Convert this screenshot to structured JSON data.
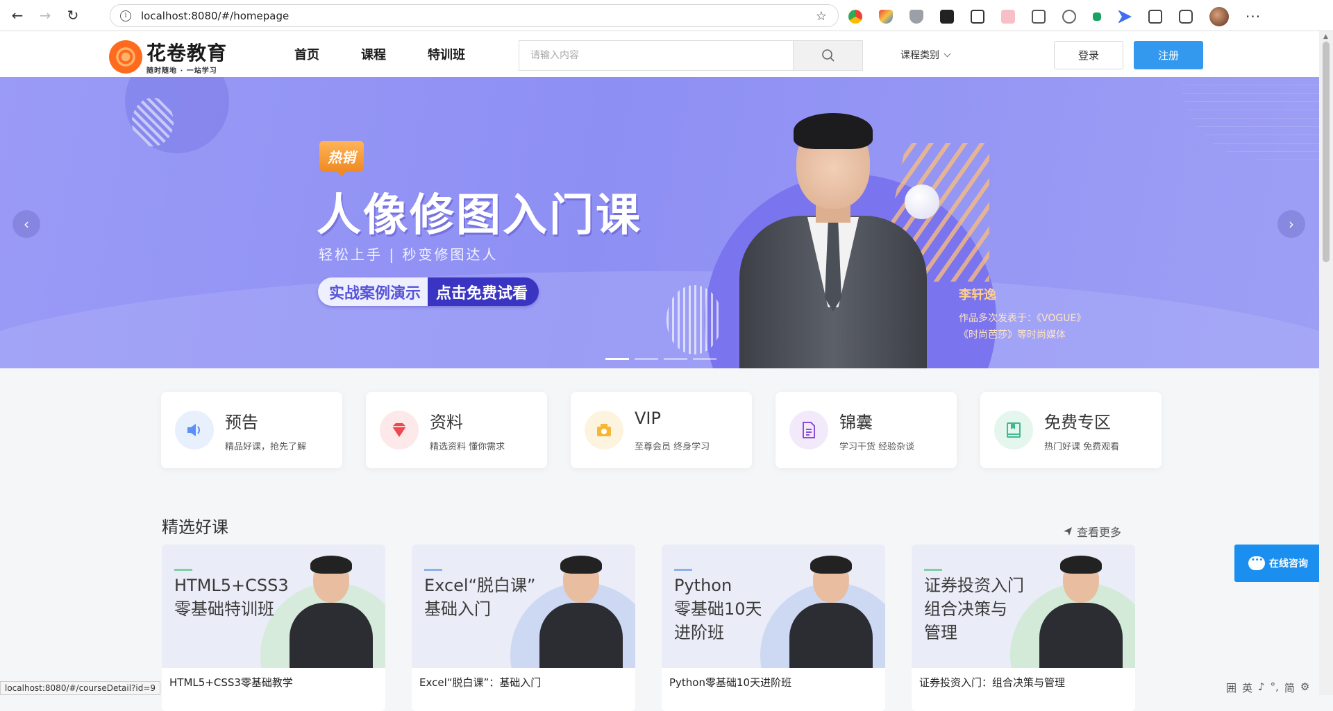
{
  "browser": {
    "url": "localhost:8080/#/homepage",
    "status_url": "localhost:8080/#/courseDetail?id=9"
  },
  "header": {
    "logo_title": "花卷教育",
    "logo_slogan": "随时随地 · 一站学习",
    "nav": [
      "首页",
      "课程",
      "特训班"
    ],
    "search_placeholder": "请输入内容",
    "category_label": "课程类别",
    "login_label": "登录",
    "register_label": "注册"
  },
  "banner": {
    "badge": "热销",
    "title": "人像修图入门课",
    "subtitle": "轻松上手 | 秒变修图达人",
    "cta_left": "实战案例演示",
    "cta_right": "点击免费试看",
    "lecturer_name": "李轩逸",
    "lecturer_desc_1": "作品多次发表于：《VOGUE》",
    "lecturer_desc_2": "《时尚芭莎》等时尚媒体",
    "prev": "‹",
    "next": "›",
    "slides": 4,
    "active_slide": 0
  },
  "categories": [
    {
      "title": "预告",
      "desc": "精品好课，抢先了解",
      "icon": "speaker-icon",
      "color": "#5b8ff9",
      "bg": "#e8effd"
    },
    {
      "title": "资料",
      "desc": "精选资料 懂你需求",
      "icon": "diamond-icon",
      "color": "#f0484f",
      "bg": "#fde9ea"
    },
    {
      "title": "VIP",
      "desc": "至尊会员 终身学习",
      "icon": "crown-icon",
      "color": "#f7b732",
      "bg": "#fdf4df"
    },
    {
      "title": "锦囊",
      "desc": "学习干货 经验杂谈",
      "icon": "document-icon",
      "color": "#8a4fd6",
      "bg": "#f2eafb"
    },
    {
      "title": "免费专区",
      "desc": "热门好课 免费观看",
      "icon": "book-icon",
      "color": "#3dbb8b",
      "bg": "#e4f6ee"
    }
  ],
  "section": {
    "title": "精选好课",
    "see_more": "查看更多"
  },
  "courses": [
    {
      "cover_text": "HTML5+CSS3\n零基础特训班",
      "name": "HTML5+CSS3零基础教学",
      "accent": "#7fd0a3",
      "circle": "#d6ebdc"
    },
    {
      "cover_text": "Excel“脱白课”\n基础入门",
      "name": "Excel“脱白课”：基础入门",
      "accent": "#8fb0e8",
      "circle": "#cdd9f2"
    },
    {
      "cover_text": "Python\n零基础10天\n进阶班",
      "name": "Python零基础10天进阶班",
      "accent": "#8fb0e8",
      "circle": "#cdd9f2"
    },
    {
      "cover_text": "证券投资入门\n组合决策与\n管理",
      "name": "证券投资入门：组合决策与管理",
      "accent": "#7fd0a3",
      "circle": "#d3ead9"
    }
  ],
  "consult_label": "在线咨询",
  "ime": [
    "囲",
    "英",
    "♪",
    "°,",
    "简",
    "⚙"
  ]
}
